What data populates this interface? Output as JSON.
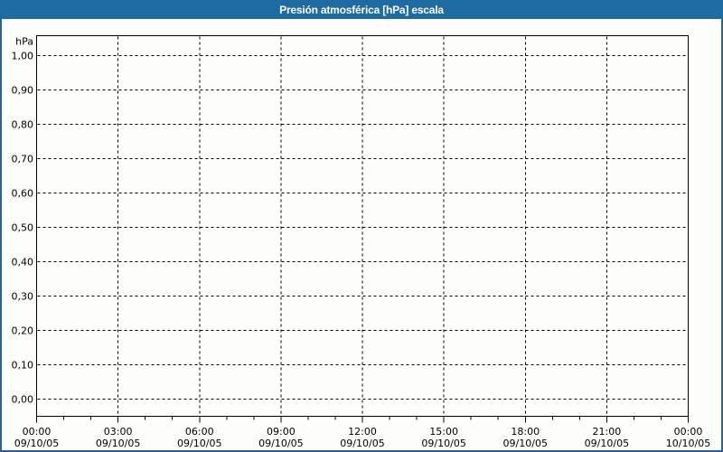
{
  "window": {
    "title_bar": {
      "title": "Presión atmosférica [hPa] escala"
    },
    "colors": {
      "title_bar_bg": "#1E6BA1",
      "title_text": "#FFFFFF",
      "frame_border": "#2C6193",
      "page_bg": "#FDFEFC",
      "plot_border": "#000000",
      "grid_line": "#000000",
      "axis_text": "#000000"
    }
  },
  "chart_data": {
    "type": "line",
    "title": "Presión atmosférica [hPa] escala",
    "y_axis": {
      "unit_label": "hPa",
      "ylim": [
        0.0,
        1.0
      ],
      "tick_step": 0.1,
      "ticks": [
        {
          "label": "1,00",
          "value": 1.0
        },
        {
          "label": "0,90",
          "value": 0.9
        },
        {
          "label": "0,80",
          "value": 0.8
        },
        {
          "label": "0,70",
          "value": 0.7
        },
        {
          "label": "0,60",
          "value": 0.6
        },
        {
          "label": "0,50",
          "value": 0.5
        },
        {
          "label": "0,40",
          "value": 0.4
        },
        {
          "label": "0,30",
          "value": 0.3
        },
        {
          "label": "0,20",
          "value": 0.2
        },
        {
          "label": "0,10",
          "value": 0.1
        },
        {
          "label": "0,00",
          "value": 0.0
        }
      ]
    },
    "x_axis": {
      "span_hours": 24,
      "major_tick_interval_hours": 3,
      "minor_tick_interval_hours": 1,
      "ticks": [
        {
          "time": "00:00",
          "date": "09/10/05",
          "hour": 0
        },
        {
          "time": "03:00",
          "date": "09/10/05",
          "hour": 3
        },
        {
          "time": "06:00",
          "date": "09/10/05",
          "hour": 6
        },
        {
          "time": "09:00",
          "date": "09/10/05",
          "hour": 9
        },
        {
          "time": "12:00",
          "date": "09/10/05",
          "hour": 12
        },
        {
          "time": "15:00",
          "date": "09/10/05",
          "hour": 15
        },
        {
          "time": "18:00",
          "date": "09/10/05",
          "hour": 18
        },
        {
          "time": "21:00",
          "date": "09/10/05",
          "hour": 21
        },
        {
          "time": "00:00",
          "date": "10/10/05",
          "hour": 24
        }
      ]
    },
    "grid": {
      "horizontal": true,
      "vertical": true,
      "style": "dashed"
    },
    "legend": [],
    "series": []
  }
}
